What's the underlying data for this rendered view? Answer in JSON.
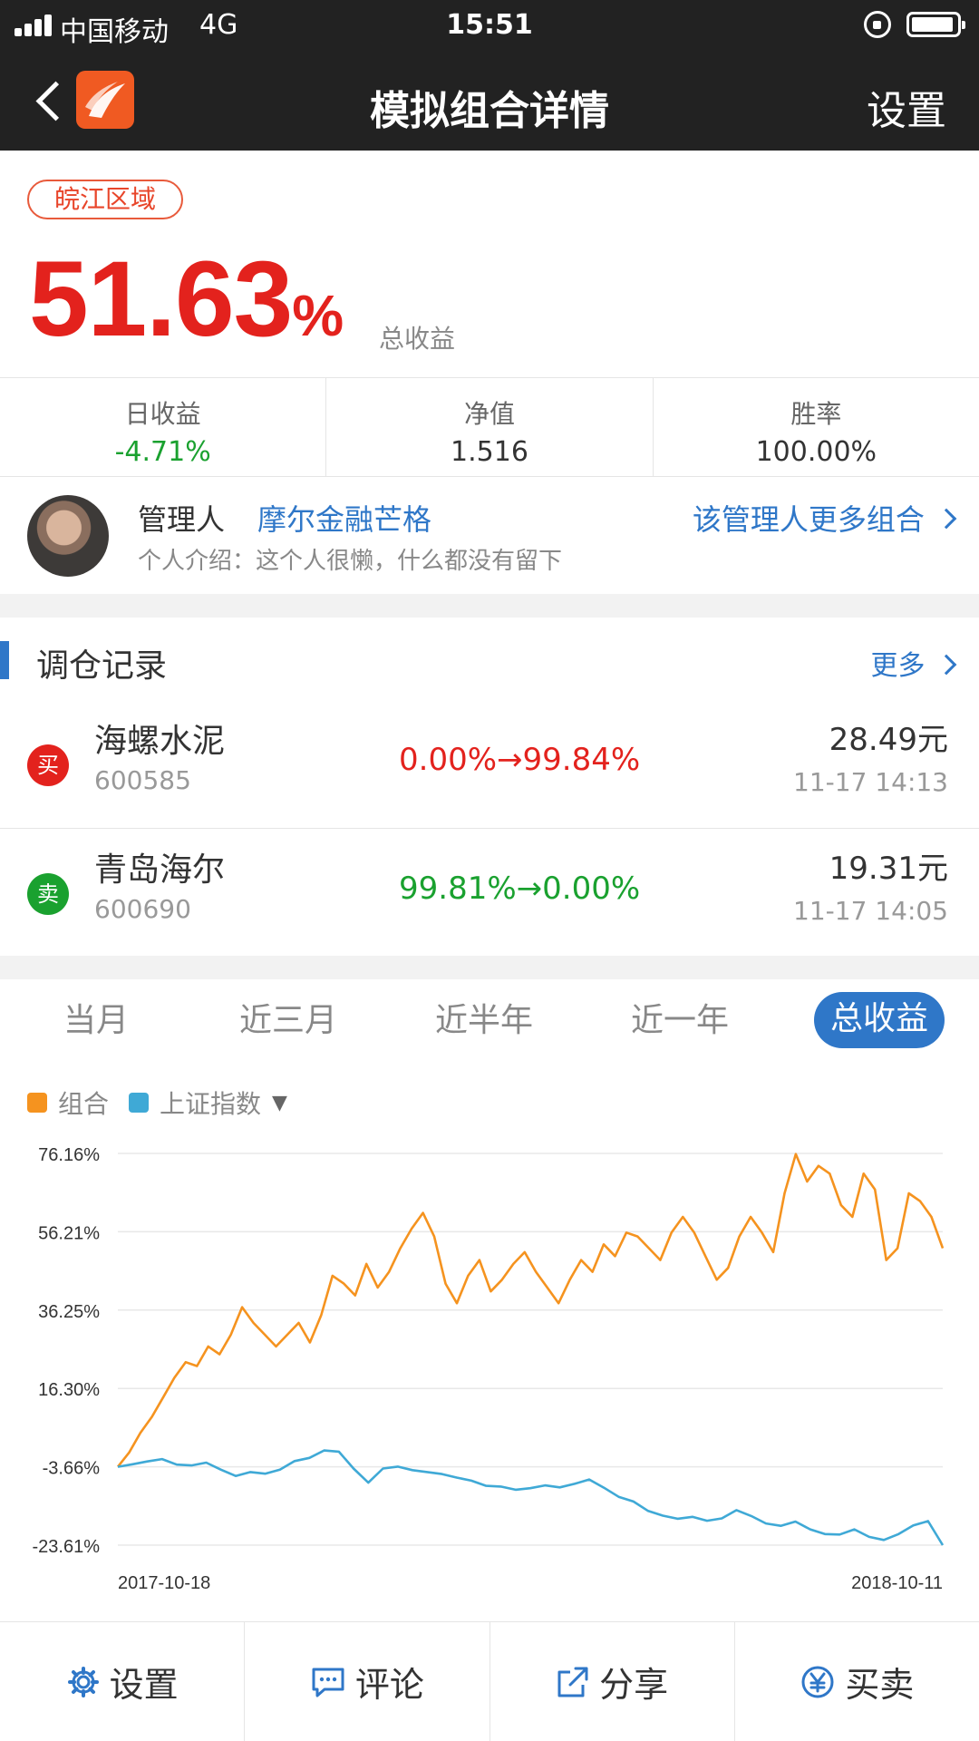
{
  "status": {
    "carrier": "中国移动",
    "network": "4G",
    "time": "15:51"
  },
  "nav": {
    "title": "模拟组合详情",
    "settings": "设置"
  },
  "tag": "皖江区域",
  "summary": {
    "total_return": "51.63",
    "percent_sign": "%",
    "total_label": "总收益"
  },
  "stats": [
    {
      "label": "日收益",
      "value": "-4.71%"
    },
    {
      "label": "净值",
      "value": "1.516"
    },
    {
      "label": "胜率",
      "value": "100.00%"
    }
  ],
  "manager": {
    "label": "管理人",
    "name": "摩尔金融芒格",
    "more": "该管理人更多组合",
    "intro": "个人介绍：这个人很懒，什么都没有留下"
  },
  "trades_section": {
    "title": "调仓记录",
    "more": "更多"
  },
  "trades": [
    {
      "badge": "买",
      "name": "海螺水泥",
      "code": "600585",
      "change": "0.00%→99.84%",
      "price": "28.49元",
      "time": "11-17 14:13",
      "color": "#e3221d"
    },
    {
      "badge": "卖",
      "name": "青岛海尔",
      "code": "600690",
      "change": "99.81%→0.00%",
      "price": "19.31元",
      "time": "11-17 14:05",
      "color": "#1aa12f"
    }
  ],
  "tabs": [
    "当月",
    "近三月",
    "近半年",
    "近一年",
    "总收益"
  ],
  "active_tab": "总收益",
  "legend": [
    {
      "name": "组合",
      "color": "#f5931f"
    },
    {
      "name": "上证指数",
      "color": "#3fa9d6"
    }
  ],
  "chart_data": {
    "type": "line",
    "title": "",
    "xlabel": "",
    "ylabel": "",
    "y_ticks": [
      "76.16%",
      "56.21%",
      "36.25%",
      "16.30%",
      "-3.66%",
      "-23.61%"
    ],
    "ylim": [
      -23.61,
      76.16
    ],
    "x_start": "2017-10-18",
    "x_end": "2018-10-11",
    "series": [
      {
        "name": "组合",
        "color": "#f5931f",
        "values": [
          -3.66,
          0,
          5,
          9,
          14,
          19,
          23,
          22,
          27,
          25,
          30,
          37,
          33,
          30,
          27,
          30,
          33,
          28,
          35,
          45,
          43,
          40,
          48,
          42,
          46,
          52,
          57,
          61,
          55,
          43,
          38,
          45,
          49,
          41,
          44,
          48,
          51,
          46,
          42,
          38,
          44,
          49,
          46,
          53,
          50,
          56,
          55,
          52,
          49,
          56,
          60,
          56,
          50,
          44,
          47,
          55,
          60,
          56,
          51,
          66,
          76,
          69,
          73,
          71,
          63,
          60,
          71,
          67,
          49,
          52,
          66,
          64,
          60,
          52
        ]
      },
      {
        "name": "上证指数",
        "color": "#3fa9d6",
        "values": [
          -3.66,
          -3.0,
          -2.3,
          -1.7,
          -3.1,
          -3.3,
          -2.6,
          -4.4,
          -6.0,
          -5.0,
          -5.4,
          -4.4,
          -2.2,
          -1.4,
          0.5,
          0.2,
          -4.1,
          -7.7,
          -4.1,
          -3.6,
          -4.5,
          -5.0,
          -5.5,
          -6.4,
          -7.2,
          -8.5,
          -8.7,
          -9.5,
          -9.1,
          -8.4,
          -8.9,
          -8.0,
          -6.9,
          -9.0,
          -11.3,
          -12.5,
          -14.9,
          -16.1,
          -16.9,
          -16.4,
          -17.4,
          -16.8,
          -14.7,
          -16.2,
          -18.1,
          -18.7,
          -17.6,
          -19.6,
          -20.8,
          -20.9,
          -19.6,
          -21.5,
          -22.3,
          -20.8,
          -18.6,
          -17.5,
          -23.6
        ]
      }
    ],
    "grid": true,
    "legend_position": "top-left"
  },
  "tabbar": [
    {
      "label": "设置",
      "icon": "gear-icon"
    },
    {
      "label": "评论",
      "icon": "comment-icon"
    },
    {
      "label": "分享",
      "icon": "share-icon"
    },
    {
      "label": "买卖",
      "icon": "yuan-icon"
    }
  ]
}
